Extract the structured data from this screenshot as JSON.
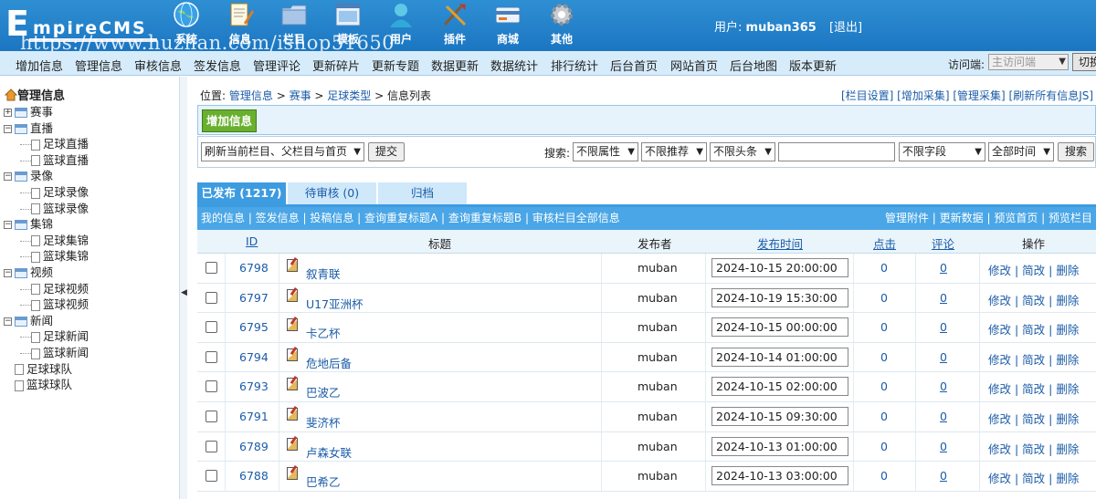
{
  "header": {
    "logo_text": "EmpireCMS",
    "watermark": "https://www.huzhan.com/ishop51650",
    "nav": [
      {
        "label": "系统",
        "icon": "globe-icon"
      },
      {
        "label": "信息",
        "icon": "document-edit-icon"
      },
      {
        "label": "栏目",
        "icon": "folder-icon"
      },
      {
        "label": "模板",
        "icon": "window-template-icon"
      },
      {
        "label": "用户",
        "icon": "user-icon"
      },
      {
        "label": "插件",
        "icon": "tools-icon"
      },
      {
        "label": "商城",
        "icon": "card-icon"
      },
      {
        "label": "其他",
        "icon": "gear-icon"
      }
    ],
    "user_label": "用户:",
    "username": "muban365",
    "logout": "[退出]"
  },
  "menubar": {
    "items": [
      "增加信息",
      "管理信息",
      "审核信息",
      "签发信息",
      "管理评论",
      "更新碎片",
      "更新专题",
      "数据更新",
      "数据统计",
      "排行统计",
      "后台首页",
      "网站首页",
      "后台地图",
      "版本更新"
    ],
    "visit_label": "访问端:",
    "visit_value": "主访问端",
    "switch_label": "切换"
  },
  "sidebar": {
    "title": "管理信息",
    "tree": [
      {
        "label": "赛事",
        "level": 0,
        "expander": "+"
      },
      {
        "label": "直播",
        "level": 0,
        "expander": "-"
      },
      {
        "label": "足球直播",
        "level": 1
      },
      {
        "label": "篮球直播",
        "level": 1
      },
      {
        "label": "录像",
        "level": 0,
        "expander": "-"
      },
      {
        "label": "足球录像",
        "level": 1
      },
      {
        "label": "篮球录像",
        "level": 1
      },
      {
        "label": "集锦",
        "level": 0,
        "expander": "-"
      },
      {
        "label": "足球集锦",
        "level": 1
      },
      {
        "label": "篮球集锦",
        "level": 1
      },
      {
        "label": "视频",
        "level": 0,
        "expander": "-"
      },
      {
        "label": "足球视频",
        "level": 1
      },
      {
        "label": "篮球视频",
        "level": 1
      },
      {
        "label": "新闻",
        "level": 0,
        "expander": "-"
      },
      {
        "label": "足球新闻",
        "level": 1
      },
      {
        "label": "篮球新闻",
        "level": 1
      },
      {
        "label": "足球球队",
        "level": 0
      },
      {
        "label": "篮球球队",
        "level": 0
      }
    ]
  },
  "breadcrumb": {
    "prefix": "位置:",
    "items": [
      "管理信息",
      "赛事",
      "足球类型"
    ],
    "current": "信息列表"
  },
  "toplinks": "[栏目设置] [增加采集] [管理采集] [刷新所有信息JS]",
  "add_button": "增加信息",
  "filter": {
    "refresh_select": "刷新当前栏目、父栏目与首页",
    "submit": "提交",
    "search_label": "搜索:",
    "attr_select": "不限属性",
    "recommend_select": "不限推荐",
    "headline_select": "不限头条",
    "keyword_value": "",
    "field_select": "不限字段",
    "time_select": "全部时间",
    "search_button": "搜索"
  },
  "tabs": [
    "已发布 (1217)",
    "待审核 (0)",
    "归档"
  ],
  "table_links": {
    "left": "我的信息 | 签发信息 | 投稿信息 | 查询重复标题A | 查询重复标题B | 审核栏目全部信息",
    "right": "管理附件 | 更新数据 | 预览首页 | 预览栏目"
  },
  "columns": {
    "id": "ID",
    "title": "标题",
    "publisher": "发布者",
    "time": "发布时间",
    "clicks": "点击",
    "comments": "评论",
    "ops": "操作"
  },
  "rows": [
    {
      "id": "6798",
      "title": "叙青联",
      "publisher": "muban",
      "time": "2024-10-15 20:00:00",
      "clicks": "0",
      "comments": "0",
      "ops": "修改 | 简改 | 删除"
    },
    {
      "id": "6797",
      "title": "U17亚洲杯",
      "publisher": "muban",
      "time": "2024-10-19 15:30:00",
      "clicks": "0",
      "comments": "0",
      "ops": "修改 | 简改 | 删除"
    },
    {
      "id": "6795",
      "title": "卡乙杯",
      "publisher": "muban",
      "time": "2024-10-15 00:00:00",
      "clicks": "0",
      "comments": "0",
      "ops": "修改 | 简改 | 删除"
    },
    {
      "id": "6794",
      "title": "危地后备",
      "publisher": "muban",
      "time": "2024-10-14 01:00:00",
      "clicks": "0",
      "comments": "0",
      "ops": "修改 | 简改 | 删除"
    },
    {
      "id": "6793",
      "title": "巴波乙",
      "publisher": "muban",
      "time": "2024-10-15 02:00:00",
      "clicks": "0",
      "comments": "0",
      "ops": "修改 | 简改 | 删除"
    },
    {
      "id": "6791",
      "title": "斐济杯",
      "publisher": "muban",
      "time": "2024-10-15 09:30:00",
      "clicks": "0",
      "comments": "0",
      "ops": "修改 | 简改 | 删除"
    },
    {
      "id": "6789",
      "title": "卢森女联",
      "publisher": "muban",
      "time": "2024-10-13 01:00:00",
      "clicks": "0",
      "comments": "0",
      "ops": "修改 | 简改 | 删除"
    },
    {
      "id": "6788",
      "title": "巴希乙",
      "publisher": "muban",
      "time": "2024-10-13 03:00:00",
      "clicks": "0",
      "comments": "0",
      "ops": "修改 | 简改 | 删除"
    }
  ]
}
